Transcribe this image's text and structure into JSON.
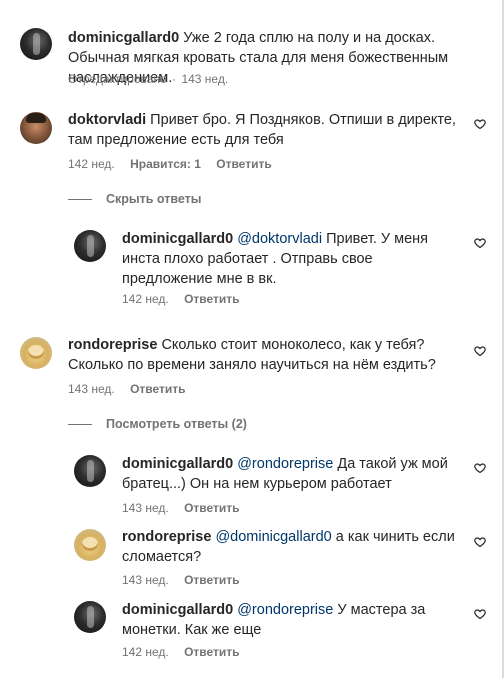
{
  "comments": [
    {
      "username": "dominicgallard0",
      "text": "Уже 2 года сплю на полу и на досках. Обычная мягкая кровать стала для меня божественным наслаждением.",
      "edited": "Отредактировано",
      "time": "143 нед."
    },
    {
      "username": "doktorvladi",
      "text": "Привет бро. Я Поздняков. Отпиши в директе, там предложение есть для тебя",
      "time": "142 нед.",
      "likes": "Нравится: 1",
      "reply_label": "Ответить"
    },
    {
      "username": "rondoreprise",
      "text": "Сколько стоит моноколесо, как у тебя? Сколько по времени заняло научиться на нём ездить?",
      "time": "143 нед.",
      "reply_label": "Ответить"
    }
  ],
  "toggles": {
    "hide_replies": "Скрыть ответы",
    "view_replies": "Посмотреть ответы (2)"
  },
  "replies": [
    {
      "username": "dominicgallard0",
      "mention": "@doktorvladi",
      "text": "Привет. У меня инста плохо работает . Отправь свое предложение мне в вк.",
      "time": "142 нед.",
      "reply_label": "Ответить"
    },
    {
      "username": "dominicgallard0",
      "mention": "@rondoreprise",
      "text": "Да такой уж мой братец...) Он на нем курьером работает",
      "time": "143 нед.",
      "reply_label": "Ответить"
    },
    {
      "username": "rondoreprise",
      "mention": "@dominicgallard0",
      "text": "а как чинить если сломается?",
      "time": "143 нед.",
      "reply_label": "Ответить"
    },
    {
      "username": "dominicgallard0",
      "mention": "@rondoreprise",
      "text": "У мастера за монетки. Как же еще",
      "time": "142 нед.",
      "reply_label": "Ответить"
    }
  ],
  "icons": {
    "heart": "heart-outline-icon"
  }
}
